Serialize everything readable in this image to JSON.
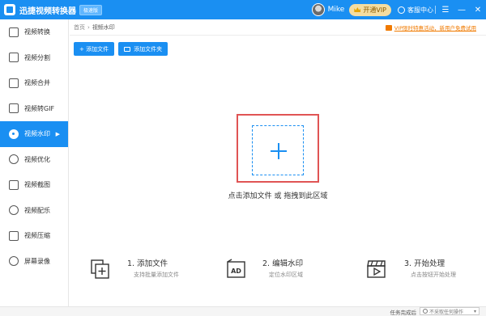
{
  "app": {
    "title": "迅捷视频转换器",
    "badge": "极速版"
  },
  "user": {
    "name": "Mike",
    "vip_label": "开通VIP",
    "support_label": "客服中心"
  },
  "window_controls": {
    "menu": "☰",
    "minimize": "—",
    "close": "✕"
  },
  "sidebar": {
    "items": [
      {
        "label": "视频转换",
        "icon": "video-convert-icon"
      },
      {
        "label": "视频分割",
        "icon": "video-split-icon"
      },
      {
        "label": "视频合并",
        "icon": "video-merge-icon"
      },
      {
        "label": "视频转GIF",
        "icon": "gif-icon"
      },
      {
        "label": "视频水印",
        "icon": "watermark-icon",
        "active": true
      },
      {
        "label": "视频优化",
        "icon": "optimize-icon"
      },
      {
        "label": "视频截图",
        "icon": "screenshot-icon"
      },
      {
        "label": "视频配乐",
        "icon": "music-icon"
      },
      {
        "label": "视频压缩",
        "icon": "compress-icon"
      },
      {
        "label": "屏幕录像",
        "icon": "record-icon"
      }
    ]
  },
  "breadcrumb": {
    "home": "首页",
    "separator": "›",
    "current": "视频水印"
  },
  "promo": {
    "text": "VIP限时特惠活动，新用户免费试用"
  },
  "toolbar": {
    "add_file": "+ 添加文件",
    "add_folder": "添加文件夹"
  },
  "dropzone": {
    "hint": "点击添加文件 或 拖拽到此区域",
    "plus": "+"
  },
  "steps": [
    {
      "title": "1. 添加文件",
      "desc": "支持批量添加文件",
      "icon": "add-file-icon"
    },
    {
      "title": "2. 编辑水印",
      "desc": "定位水印区域",
      "icon": "ad-watermark-icon",
      "icon_text": "AD"
    },
    {
      "title": "3. 开始处理",
      "desc": "点击按钮开始处理",
      "icon": "clapper-icon"
    }
  ],
  "statusbar": {
    "label": "任务完成后",
    "select_value": "不采取任何操作"
  },
  "colors": {
    "accent": "#1a8ff2",
    "highlight_border": "#e05454",
    "promo": "#f07a00",
    "vip_bg": "#f4dda1"
  }
}
